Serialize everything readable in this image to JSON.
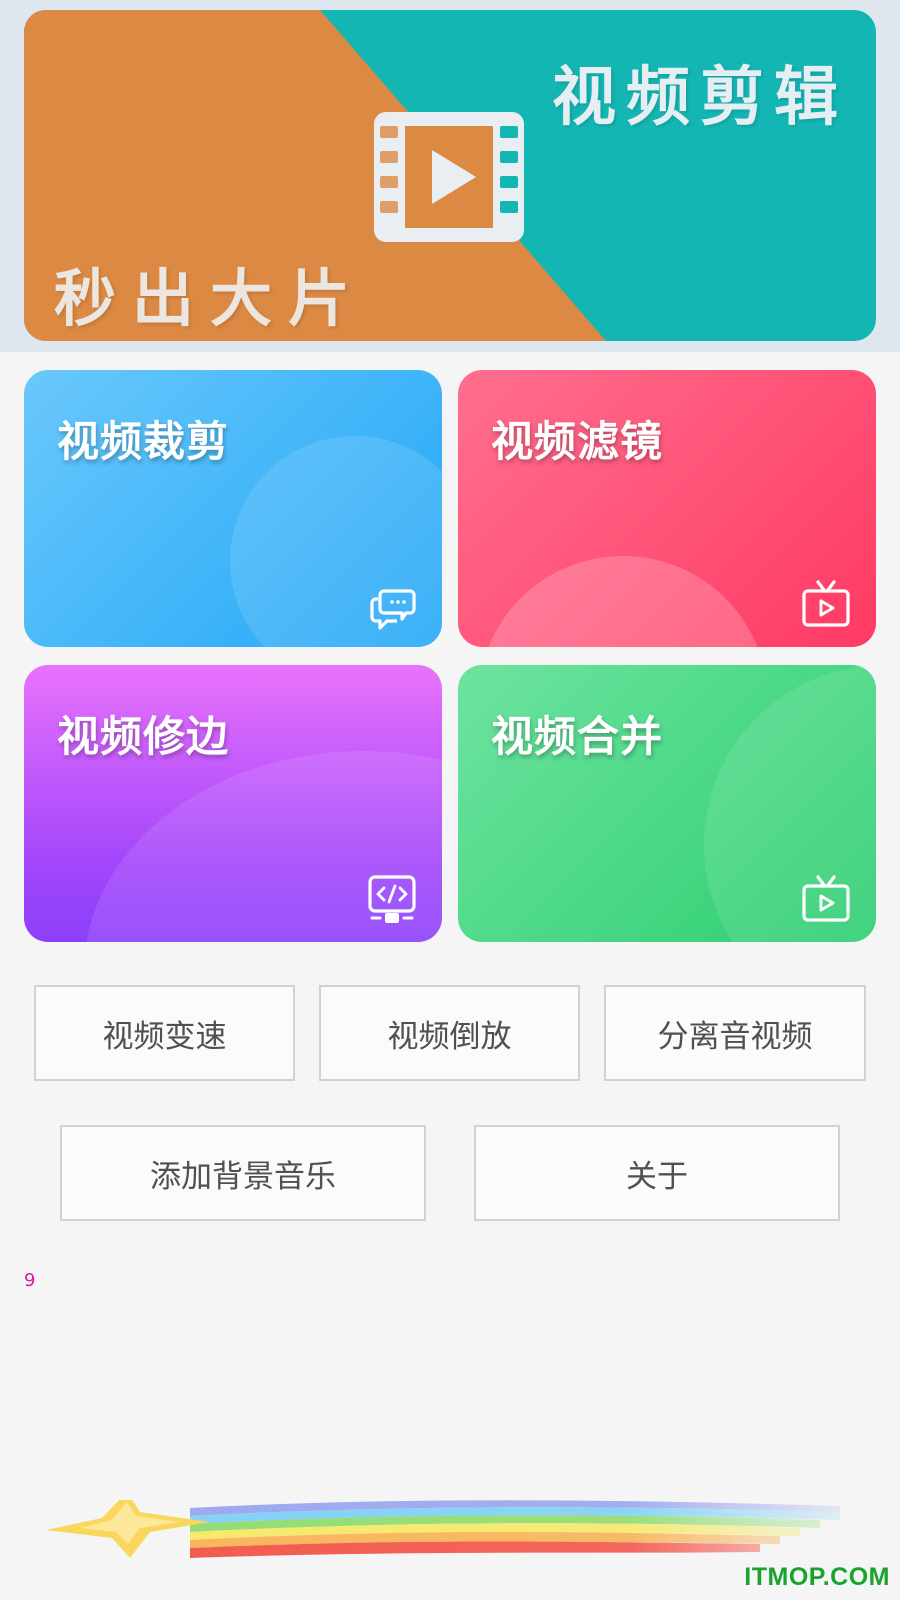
{
  "banner": {
    "title": "视频剪辑",
    "slogan": "秒出大片",
    "colors": {
      "orange": "#dc8943",
      "teal": "#14b6b4"
    },
    "icon": "film-play-icon"
  },
  "cards": [
    {
      "label": "视频裁剪",
      "icon": "chat-bubbles-icon",
      "colors": [
        "#6ac8fb",
        "#21a6f7"
      ]
    },
    {
      "label": "视频滤镜",
      "icon": "tv-play-icon",
      "colors": [
        "#ff6f8e",
        "#ff3a64"
      ]
    },
    {
      "label": "视频修边",
      "icon": "code-monitor-icon",
      "colors": [
        "#e872fc",
        "#8c3ffb"
      ]
    },
    {
      "label": "视频合并",
      "icon": "tv-play-icon",
      "colors": [
        "#6ee3a0",
        "#2cce70"
      ]
    }
  ],
  "tools": {
    "row1": [
      "视频变速",
      "视频倒放",
      "分离音视频"
    ],
    "row2": [
      "添加背景音乐",
      "关于"
    ]
  },
  "counter": "9",
  "watermark": "ITMOP.COM"
}
